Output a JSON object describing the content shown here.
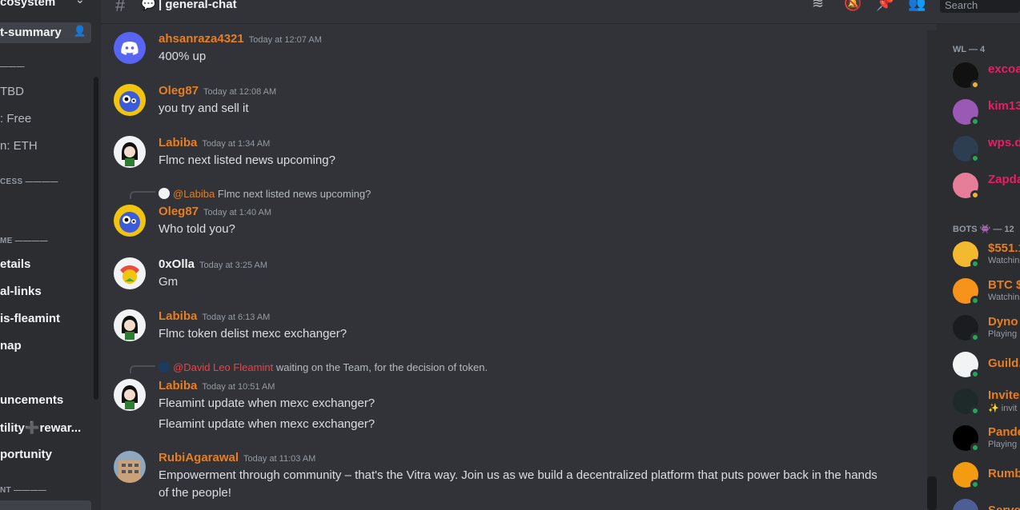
{
  "colors": {
    "accent": "#5865f2",
    "online": "#23a55a",
    "idle": "#f0b232",
    "username_orange": "#e67e22",
    "mention_red": "#ed4245",
    "pink": "#e91e63"
  },
  "sidebar": {
    "server_name": "cosystem",
    "active_channel": "t-summary",
    "lines": [
      {
        "text": "———",
        "kind": "cat"
      },
      {
        "text": "TBD",
        "kind": "dim"
      },
      {
        "text": ": Free",
        "kind": "dim"
      },
      {
        "text": "n: ETH",
        "kind": "dim"
      },
      {
        "text": "CESS ————",
        "kind": "cat"
      },
      {
        "text": "ME ————",
        "kind": "cat"
      },
      {
        "text": "etails",
        "kind": "bright"
      },
      {
        "text": "al-links",
        "kind": "bright"
      },
      {
        "text": "is-fleamint",
        "kind": "bright"
      },
      {
        "text": "nap",
        "kind": "bright"
      },
      {
        "text": "uncements",
        "kind": "bright"
      },
      {
        "text": "tility➕rewar...",
        "kind": "bright"
      },
      {
        "text": "portunity",
        "kind": "bright"
      },
      {
        "text": "NT ————",
        "kind": "cat"
      }
    ]
  },
  "header": {
    "channel_icon": "hash-icon",
    "channel_name": "| general-chat",
    "search_placeholder": "Search"
  },
  "messages": [
    {
      "user": "ahsanraza4321",
      "color": "#e67e22",
      "time": "Today at 12:07 AM",
      "lines": [
        "400% up"
      ],
      "avatar": "discord-default"
    },
    {
      "user": "Oleg87",
      "color": "#e67e22",
      "time": "Today at 12:08 AM",
      "lines": [
        "you try and sell it"
      ],
      "avatar": "blue-bird"
    },
    {
      "user": "Labiba",
      "color": "#e67e22",
      "time": "Today at 1:34 AM",
      "lines": [
        "Flmc next listed news upcoming?"
      ],
      "avatar": "anime-girl"
    },
    {
      "user": "Oleg87",
      "color": "#e67e22",
      "time": "Today at 1:40 AM",
      "lines": [
        "Who told you?"
      ],
      "avatar": "blue-bird",
      "reply_to": "@Labiba",
      "reply_text": "Flmc next listed news upcoming?",
      "reply_color": "#e67e22"
    },
    {
      "user": "0xOlla",
      "color": "#f2f3f5",
      "time": "Today at 3:25 AM",
      "lines": [
        "Gm"
      ],
      "avatar": "parrot"
    },
    {
      "user": "Labiba",
      "color": "#e67e22",
      "time": "Today at 6:13 AM",
      "lines": [
        "Flmc token delist mexc exchanger?"
      ],
      "avatar": "anime-girl"
    },
    {
      "user": "Labiba",
      "color": "#e67e22",
      "time": "Today at 10:51 AM",
      "lines": [
        "Fleamint update when mexc exchanger?",
        "Fleamint update when mexc exchanger?"
      ],
      "avatar": "anime-girl",
      "reply_to": "@David Leo Fleamint",
      "reply_text": "waiting on the Team, for the decision of token.",
      "reply_color": "#ed4245"
    },
    {
      "user": "RubiAgarawal",
      "color": "#e67e22",
      "time": "Today at 11:03 AM",
      "lines": [
        "Empowerment through community – that's the Vitra way. Join us as we build a decentralized platform that puts power back in the hands of the people!"
      ],
      "avatar": "building"
    }
  ],
  "members": {
    "wl_header": "WL — 4",
    "wl": [
      {
        "name": "excoa",
        "color": "#e91e63",
        "status": "idle",
        "avatar_color": "#111111"
      },
      {
        "name": "kim13",
        "color": "#e91e63",
        "status": "online",
        "avatar_color": "#9b59b6"
      },
      {
        "name": "wps.d",
        "color": "#e91e63",
        "status": "online",
        "avatar_color": "#2c3e50"
      },
      {
        "name": "Zapda",
        "color": "#e91e63",
        "status": "idle",
        "avatar_color": "#e67e9a"
      }
    ],
    "bots_header": "BOTS 👾 — 12",
    "bots": [
      {
        "name": "$551.1",
        "sub": "Watchin",
        "color": "#e67e22",
        "status": "online",
        "avatar_color": "#f3ba2f"
      },
      {
        "name": "BTC $",
        "sub": "Watchin",
        "color": "#e67e22",
        "status": "online",
        "avatar_color": "#f7931a"
      },
      {
        "name": "Dyno",
        "sub": "Playing",
        "color": "#e67e22",
        "status": "online",
        "avatar_color": "#1a1c20"
      },
      {
        "name": "Guild.",
        "sub": "",
        "color": "#e67e22",
        "status": "online",
        "avatar_color": "#f2f3f5"
      },
      {
        "name": "Invite",
        "sub": "✨ invit",
        "color": "#e67e22",
        "status": "online",
        "avatar_color": "#1e2a2a"
      },
      {
        "name": "Pande",
        "sub": "Playing",
        "color": "#e67e22",
        "status": "online",
        "avatar_color": "#000000"
      },
      {
        "name": "Rumb",
        "sub": "",
        "color": "#e67e22",
        "status": "online",
        "avatar_color": "#f39c12"
      },
      {
        "name": "Serve",
        "sub": "",
        "color": "#e67e22",
        "status": "online",
        "avatar_color": "#4e5d94"
      }
    ]
  }
}
